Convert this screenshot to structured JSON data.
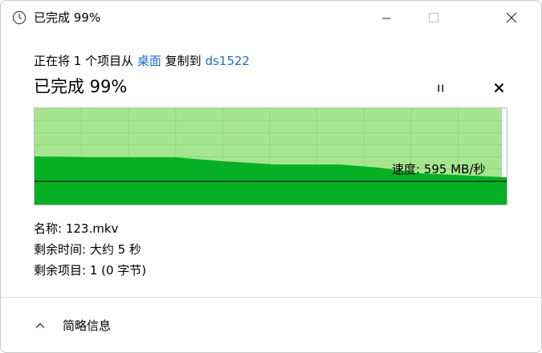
{
  "window": {
    "title": "已完成 99%"
  },
  "copy": {
    "prefix": "正在将 1 个项目从",
    "source": "桌面",
    "middle": "复制到",
    "destination": "ds1522"
  },
  "status": {
    "headline": "已完成 99%",
    "progress_percent": 99
  },
  "speed": {
    "label": "速度: 595 MB/秒"
  },
  "details": {
    "name": "名称: 123.mkv",
    "time_remaining": "剩余时间: 大约 5 秒",
    "items_remaining": "剩余项目: 1 (0 字节)"
  },
  "footer": {
    "toggle_label": "简略信息"
  },
  "colors": {
    "progress_light": "#a6e58f",
    "progress_dark": "#06b025",
    "link": "#1a6fc7"
  },
  "icons": {
    "title": "clock-icon",
    "minimize": "minimize-icon",
    "maximize": "maximize-icon",
    "close": "close-icon",
    "pause": "pause-icon",
    "cancel": "cancel-icon",
    "toggle": "chevron-up-icon"
  }
}
